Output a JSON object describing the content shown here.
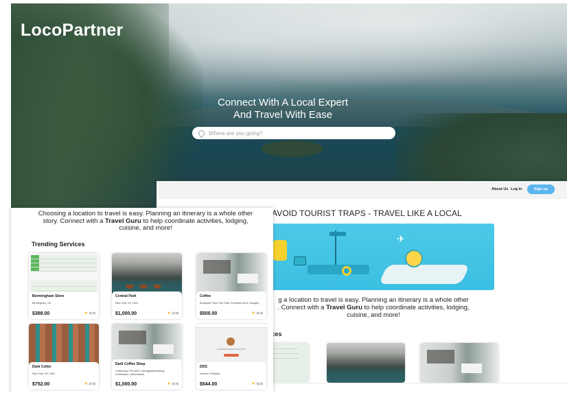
{
  "app": {
    "logo": "LocoPartner"
  },
  "hero": {
    "title_line1": "Connect With A Local Expert",
    "title_line2": "And Travel With Ease",
    "search_placeholder": "Where are you going?"
  },
  "nav": {
    "about": "About Us",
    "login": "Log in",
    "signup": "Sign up"
  },
  "back_page": {
    "headline": "AVOID TOURIST TRAPS - TRAVEL LIKE A LOCAL",
    "desc_pre": "g a location to travel is easy. Planning an itinerary is a whole other",
    "desc_mid_pre": ". Connect with a ",
    "desc_bold": "Travel Guru",
    "desc_mid_post": " to help coordinate activities, lodging,",
    "desc_end": "cuisine, and more!",
    "services_label": "vices"
  },
  "front_page": {
    "desc_line1": "Choosing a location to travel is easy. Planning an itinerary is a whole other",
    "desc_line2_pre": "story. Connect with a ",
    "desc_bold": "Travel Guru",
    "desc_line2_post": " to help coordinate activities, lodging,",
    "desc_line3": "cuisine, and more!",
    "section_title": "Trending Services"
  },
  "services": [
    {
      "name": "Bermingham Store",
      "location": "Birmingham, UK",
      "price": "$388.00",
      "rating": "(0.0)"
    },
    {
      "name": "Central Park",
      "location": "New York, NY, USA",
      "price": "$1,000.00",
      "rating": "(0.0)"
    },
    {
      "name": "Coffee",
      "location": "Budapest, New York Cafe, Erzsébet körút, Hungary",
      "price": "$500.00",
      "rating": "(5.0)"
    },
    {
      "name": "Dark Cofee",
      "location": "New York, NY, USA",
      "price": "$752.00",
      "rating": "(0.0)"
    },
    {
      "name": "Dark Coffee Shop",
      "location": "Coffeeshop Pre-Ahm, Haringpakkerssteeg,",
      "location2": "Amsterdam, Netherlands",
      "price": "$1,000.00",
      "rating": "(0.0)"
    },
    {
      "name": "DDS",
      "location": "Karachi, Pakistan",
      "price": "$544.00",
      "rating": "(5.0)"
    }
  ],
  "icons": {
    "search": "location-pin-icon",
    "rating": "star-icon"
  },
  "colors": {
    "signup": "#5cb6ee",
    "banner": "#3bbfe2",
    "star": "#f5b50a"
  }
}
